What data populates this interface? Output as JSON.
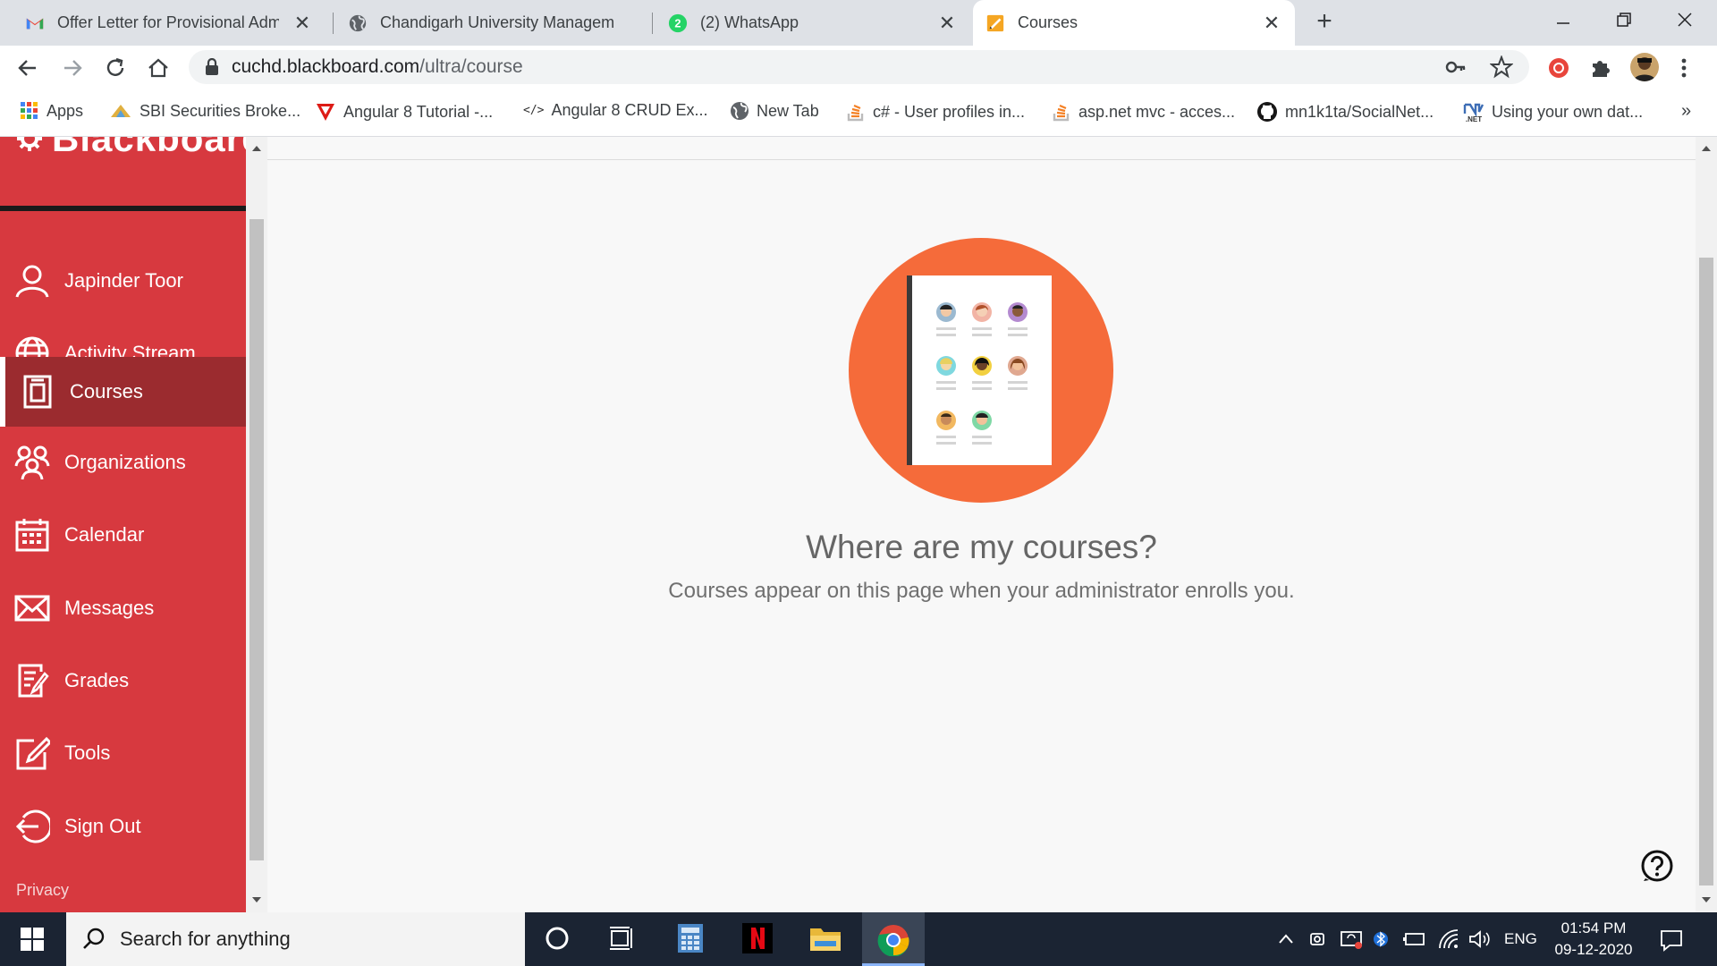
{
  "browser": {
    "tabs": [
      {
        "title": "Offer Letter for Provisional Admis",
        "icon": "gmail-icon"
      },
      {
        "title": "Chandigarh University Managem",
        "icon": "globe-icon"
      },
      {
        "title": "(2) WhatsApp",
        "icon": "whatsapp-icon",
        "badge": "2"
      },
      {
        "title": "Courses",
        "icon": "blackboard-icon",
        "active": true
      }
    ],
    "url_host": "cuchd.blackboard.com",
    "url_path": "/ultra/course",
    "bookmarks": [
      {
        "label": "Apps",
        "icon": "apps-grid-icon"
      },
      {
        "label": "SBI Securities Broke...",
        "icon": "sbi-icon"
      },
      {
        "label": "Angular 8 Tutorial -...",
        "icon": "angular-icon"
      },
      {
        "label": "Angular 8 CRUD Ex...",
        "icon": "code-icon"
      },
      {
        "label": "New Tab",
        "icon": "globe-icon"
      },
      {
        "label": "c# - User profiles in...",
        "icon": "stackoverflow-icon"
      },
      {
        "label": "asp.net mvc - acces...",
        "icon": "stackoverflow-icon"
      },
      {
        "label": "mn1k1ta/SocialNet...",
        "icon": "github-icon"
      },
      {
        "label": "Using your own dat...",
        "icon": "dotnet-icon"
      }
    ],
    "bookmarks_overflow": "»",
    "dotnet_badge": ".NET"
  },
  "sidebar": {
    "brand": "Blackboard",
    "items": [
      {
        "label": "Japinder Toor",
        "icon": "user-icon"
      },
      {
        "label": "Activity Stream",
        "icon": "globe-icon"
      },
      {
        "label": "Courses",
        "icon": "courses-icon",
        "active": true
      },
      {
        "label": "Organizations",
        "icon": "organizations-icon"
      },
      {
        "label": "Calendar",
        "icon": "calendar-icon"
      },
      {
        "label": "Messages",
        "icon": "envelope-icon"
      },
      {
        "label": "Grades",
        "icon": "grades-icon"
      },
      {
        "label": "Tools",
        "icon": "tools-icon"
      },
      {
        "label": "Sign Out",
        "icon": "sign-out-icon"
      }
    ],
    "privacy": "Privacy"
  },
  "main": {
    "heading": "Where are my courses?",
    "subtext": "Courses appear on this page when your administrator enrolls you.",
    "help_icon": "help-icon"
  },
  "taskbar": {
    "search_placeholder": "Search for anything",
    "language": "ENG",
    "time": "01:54 PM",
    "date": "09-12-2020"
  },
  "colors": {
    "sidebar": "#d7393f",
    "sidebar_active": "#9b2b2f",
    "illustration_circle": "#f56b3a",
    "main_bg": "#f8f8f8"
  }
}
